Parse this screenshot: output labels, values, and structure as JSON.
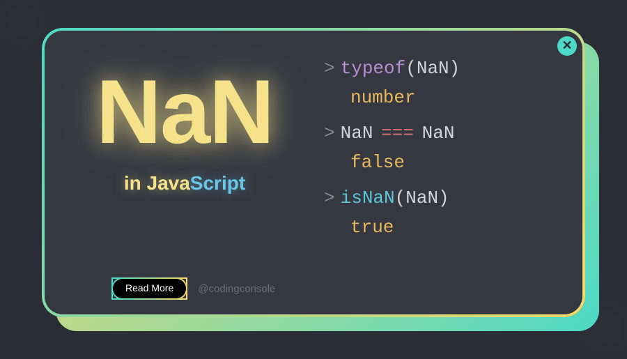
{
  "title": {
    "main": "NaN",
    "sub_in": "in ",
    "sub_java": "Java",
    "sub_script": "Script"
  },
  "cta": {
    "read_more": "Read More",
    "handle": "@codingconsole"
  },
  "code": {
    "line1": {
      "prompt": ">",
      "keyword": "typeof",
      "open": "(",
      "arg": "NaN",
      "close": ")"
    },
    "result1": "number",
    "line2": {
      "prompt": ">",
      "left": "NaN",
      "op": "===",
      "right": "NaN"
    },
    "result2": "false",
    "line3": {
      "prompt": ">",
      "fn": "isNaN",
      "open": "(",
      "arg": "NaN",
      "close": ")"
    },
    "result3": "true"
  }
}
